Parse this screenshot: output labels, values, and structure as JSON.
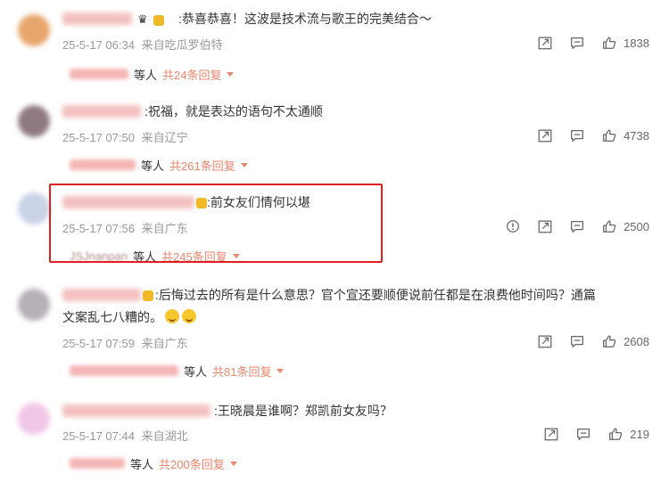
{
  "icons": {
    "forward": "forward-icon",
    "comment": "comment-icon",
    "like": "thumbs-up-icon",
    "info": "info-icon"
  },
  "colors": {
    "accent": "#e8866c",
    "highlight_border": "#e02020",
    "meta_text": "#999999"
  },
  "comments": [
    {
      "text": ":恭喜恭喜！这波是技术流与歌王的完美结合～",
      "time": "25-5-17 06:34",
      "source": "来自吃瓜罗伯特",
      "likes": "1838",
      "reply_people": "等人",
      "reply_count": "共24条回复"
    },
    {
      "text": ":祝福，就是表达的语句不太通顺",
      "time": "25-5-17 07:50",
      "source": "来自辽宁",
      "likes": "4738",
      "reply_people": "等人",
      "reply_count": "共261条回复"
    },
    {
      "text": ":前女友们情何以堪",
      "time": "25-5-17 07:56",
      "source": "来自广东",
      "likes": "2500",
      "reply_name": "JSJnanpan",
      "reply_people": "等人",
      "reply_count": "共245条回复"
    },
    {
      "text_line1": ":后悔过去的所有是什么意思？官个宣还要顺便说前任都是在浪费他时间吗？通篇",
      "text_line2": "文案乱七八糟的。",
      "time": "25-5-17 07:59",
      "source": "来自广东",
      "likes": "2608",
      "reply_people": "等人",
      "reply_count": "共81条回复"
    },
    {
      "text": ":王晓晨是谁啊？郑凯前女友吗？",
      "time": "25-5-17 07:44",
      "source": "来自湖北",
      "likes": "219",
      "reply_people": "等人",
      "reply_count": "共200条回复"
    }
  ]
}
